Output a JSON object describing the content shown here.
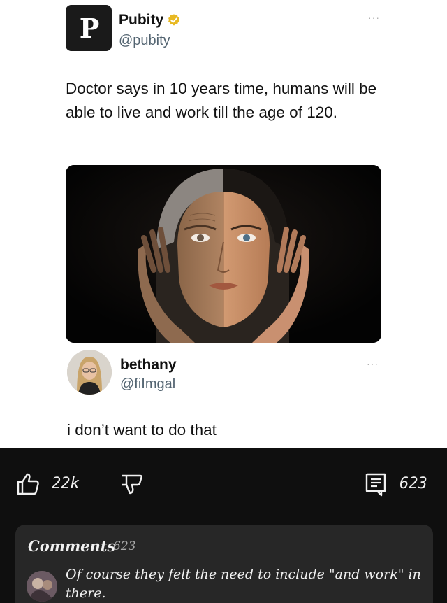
{
  "post": {
    "author_name": "Pubity",
    "author_handle": "@pubity",
    "logo_letter": "P",
    "text": "Doctor says in 10 years time, humans will be able to live and work till the age of 120.",
    "more_label": "···",
    "verified_color": "#e8b923"
  },
  "reply": {
    "author_name": "bethany",
    "author_handle": "@fiImgal",
    "text": "i don’t want to do that",
    "more_label": "···"
  },
  "actions": {
    "like_count": "22k",
    "comments_count": "623",
    "icons": [
      "thumbs-up-icon",
      "thumbs-down-icon",
      "comments-icon"
    ]
  },
  "comments": {
    "heading": "Comments",
    "count": "623",
    "top_comment": "Of course they felt the need to include \"and work\" in there."
  },
  "colors": {
    "dark_bg": "#0f0f0f",
    "card_bg": "#272727",
    "handle_gray": "#536471"
  }
}
